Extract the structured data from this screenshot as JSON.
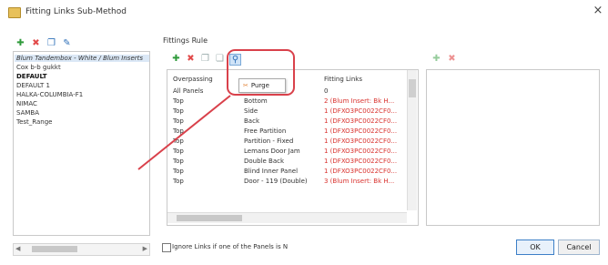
{
  "window": {
    "title": "Fitting Links Sub-Method",
    "close_glyph": "×"
  },
  "left_toolbar": {
    "icons": [
      "add-icon",
      "delete-icon",
      "copy-icon",
      "edit-icon"
    ]
  },
  "left_list": {
    "items": [
      {
        "label": "Blum Tandembox - White / Blum Inserts",
        "selected": true,
        "bold": false
      },
      {
        "label": "Cox b-b gukkt",
        "selected": false,
        "bold": false
      },
      {
        "label": "DEFAULT",
        "selected": false,
        "bold": true
      },
      {
        "label": "DEFAULT 1",
        "selected": false,
        "bold": false
      },
      {
        "label": "HALKA-COLUMBIA-F1",
        "selected": false,
        "bold": false
      },
      {
        "label": "NIMAC",
        "selected": false,
        "bold": false
      },
      {
        "label": "SAMBA",
        "selected": false,
        "bold": false
      },
      {
        "label": "Test_Range",
        "selected": false,
        "bold": false
      }
    ]
  },
  "fittings_rule": {
    "label": "Fittings Rule",
    "toolbar_icons": [
      "add-icon",
      "delete-icon",
      "copy-icon",
      "duplicate-icon",
      "purge-icon"
    ],
    "columns": [
      "Overpassing",
      "Fitting Links"
    ],
    "rows": [
      {
        "overpass": "All Panels",
        "part": "",
        "link": "0"
      },
      {
        "overpass": "Top",
        "part": "Bottom",
        "link": "2 (Blum Insert: Bk H..."
      },
      {
        "overpass": "Top",
        "part": "Side",
        "link": "1 (DFXO3PC0022CF0..."
      },
      {
        "overpass": "Top",
        "part": "Back",
        "link": "1 (DFXO3PC0022CF0..."
      },
      {
        "overpass": "Top",
        "part": "Free Partition",
        "link": "1 (DFXO3PC0022CF0..."
      },
      {
        "overpass": "Top",
        "part": "Partition - Fixed",
        "link": "1 (DFXO3PC0022CF0..."
      },
      {
        "overpass": "Top",
        "part": "Lemans Door Jam",
        "link": "1 (DFXO3PC0022CF0..."
      },
      {
        "overpass": "Top",
        "part": "Double Back",
        "link": "1 (DFXO3PC0022CF0..."
      },
      {
        "overpass": "Top",
        "part": "Blind Inner Panel",
        "link": "1 (DFXO3PC0022CF0..."
      },
      {
        "overpass": "Top",
        "part": "Door - 119 (Double)",
        "link": "3 (Blum Insert: Bk H..."
      }
    ]
  },
  "purge_popup": {
    "label": "Purge"
  },
  "right_toolbar": {
    "icons": [
      "add-icon",
      "delete-icon"
    ]
  },
  "footer": {
    "checkbox_label": "Ignore Links if one of the Panels is N",
    "ok_label": "OK",
    "cancel_label": "Cancel"
  },
  "colors": {
    "accent_red": "#d9414b",
    "link_red": "#d9322e",
    "add_green": "#2e9a3a"
  }
}
